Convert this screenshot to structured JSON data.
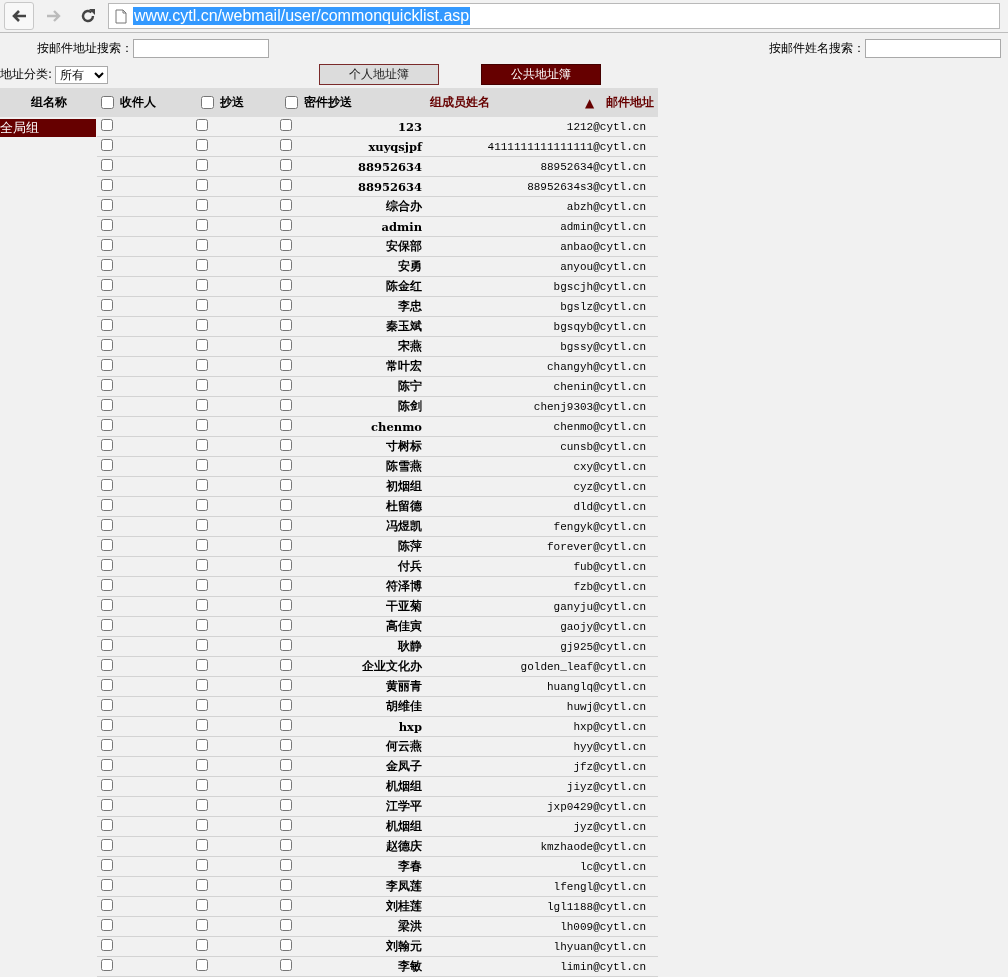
{
  "browser": {
    "url": "www.cytl.cn/webmail/user/commonquicklist.asp",
    "url_selected": true,
    "forward_disabled": true
  },
  "search": {
    "by_address_label": "按邮件地址搜索：",
    "by_name_label": "按邮件姓名搜索："
  },
  "category": {
    "label": "地址分类:",
    "value": "所有"
  },
  "address_books": [
    {
      "label": "个人地址簿",
      "selected": false
    },
    {
      "label": "公共地址簿",
      "selected": true
    }
  ],
  "table": {
    "group_header": "组名称",
    "to_header": {
      "label": "收件人",
      "checked": false
    },
    "cc_header": {
      "label": "抄送",
      "checked": false
    },
    "bcc_header": {
      "label": "密件抄送",
      "checked": false
    },
    "name_header": "组成员姓名",
    "sort_mark": "▲",
    "email_header": "邮件地址",
    "groups": [
      {
        "label": "全局组",
        "selected": true
      }
    ],
    "rows": [
      {
        "name": "123",
        "email": "1212@cytl.cn",
        "to": false,
        "cc": false,
        "bcc": false
      },
      {
        "name": "xuyqsjpf",
        "email": "4111111111111111@cytl.cn",
        "to": false,
        "cc": false,
        "bcc": false
      },
      {
        "name": "88952634",
        "email": "88952634@cytl.cn",
        "to": false,
        "cc": false,
        "bcc": false
      },
      {
        "name": "88952634",
        "email": "88952634s3@cytl.cn",
        "to": false,
        "cc": false,
        "bcc": false
      },
      {
        "name": "综合办",
        "email": "abzh@cytl.cn",
        "to": false,
        "cc": false,
        "bcc": false
      },
      {
        "name": "admin",
        "email": "admin@cytl.cn",
        "to": false,
        "cc": false,
        "bcc": false
      },
      {
        "name": "安保部",
        "email": "anbao@cytl.cn",
        "to": false,
        "cc": false,
        "bcc": false
      },
      {
        "name": "安勇",
        "email": "anyou@cytl.cn",
        "to": false,
        "cc": false,
        "bcc": false
      },
      {
        "name": "陈金红",
        "email": "bgscjh@cytl.cn",
        "to": false,
        "cc": false,
        "bcc": false
      },
      {
        "name": "李忠",
        "email": "bgslz@cytl.cn",
        "to": false,
        "cc": false,
        "bcc": false
      },
      {
        "name": "秦玉斌",
        "email": "bgsqyb@cytl.cn",
        "to": false,
        "cc": false,
        "bcc": false
      },
      {
        "name": "宋燕",
        "email": "bgssy@cytl.cn",
        "to": false,
        "cc": false,
        "bcc": false
      },
      {
        "name": "常叶宏",
        "email": "changyh@cytl.cn",
        "to": false,
        "cc": false,
        "bcc": false
      },
      {
        "name": "陈宁",
        "email": "chenin@cytl.cn",
        "to": false,
        "cc": false,
        "bcc": false
      },
      {
        "name": "陈剑",
        "email": "chenj9303@cytl.cn",
        "to": false,
        "cc": false,
        "bcc": false
      },
      {
        "name": "chenmo",
        "email": "chenmo@cytl.cn",
        "to": false,
        "cc": false,
        "bcc": false
      },
      {
        "name": "寸树标",
        "email": "cunsb@cytl.cn",
        "to": false,
        "cc": false,
        "bcc": false
      },
      {
        "name": "陈雪燕",
        "email": "cxy@cytl.cn",
        "to": false,
        "cc": false,
        "bcc": false
      },
      {
        "name": "初烟组",
        "email": "cyz@cytl.cn",
        "to": false,
        "cc": false,
        "bcc": false
      },
      {
        "name": "杜留德",
        "email": "dld@cytl.cn",
        "to": false,
        "cc": false,
        "bcc": false
      },
      {
        "name": "冯煜凯",
        "email": "fengyk@cytl.cn",
        "to": false,
        "cc": false,
        "bcc": false
      },
      {
        "name": "陈萍",
        "email": "forever@cytl.cn",
        "to": false,
        "cc": false,
        "bcc": false
      },
      {
        "name": "付兵",
        "email": "fub@cytl.cn",
        "to": false,
        "cc": false,
        "bcc": false
      },
      {
        "name": "符泽博",
        "email": "fzb@cytl.cn",
        "to": false,
        "cc": false,
        "bcc": false
      },
      {
        "name": "干亚菊",
        "email": "ganyju@cytl.cn",
        "to": false,
        "cc": false,
        "bcc": false
      },
      {
        "name": "高佳寅",
        "email": "gaojy@cytl.cn",
        "to": false,
        "cc": false,
        "bcc": false
      },
      {
        "name": "耿静",
        "email": "gj925@cytl.cn",
        "to": false,
        "cc": false,
        "bcc": false
      },
      {
        "name": "企业文化办",
        "email": "golden_leaf@cytl.cn",
        "to": false,
        "cc": false,
        "bcc": false
      },
      {
        "name": "黄丽青",
        "email": "huanglq@cytl.cn",
        "to": false,
        "cc": false,
        "bcc": false
      },
      {
        "name": "胡维佳",
        "email": "huwj@cytl.cn",
        "to": false,
        "cc": false,
        "bcc": false
      },
      {
        "name": "hxp",
        "email": "hxp@cytl.cn",
        "to": false,
        "cc": false,
        "bcc": false
      },
      {
        "name": "何云燕",
        "email": "hyy@cytl.cn",
        "to": false,
        "cc": false,
        "bcc": false
      },
      {
        "name": "金凤子",
        "email": "jfz@cytl.cn",
        "to": false,
        "cc": false,
        "bcc": false
      },
      {
        "name": "机烟组",
        "email": "jiyz@cytl.cn",
        "to": false,
        "cc": false,
        "bcc": false
      },
      {
        "name": "江学平",
        "email": "jxp0429@cytl.cn",
        "to": false,
        "cc": false,
        "bcc": false
      },
      {
        "name": "机烟组",
        "email": "jyz@cytl.cn",
        "to": false,
        "cc": false,
        "bcc": false
      },
      {
        "name": "赵德庆",
        "email": "kmzhaode@cytl.cn",
        "to": false,
        "cc": false,
        "bcc": false
      },
      {
        "name": "李春",
        "email": "lc@cytl.cn",
        "to": false,
        "cc": false,
        "bcc": false
      },
      {
        "name": "李凤莲",
        "email": "lfengl@cytl.cn",
        "to": false,
        "cc": false,
        "bcc": false
      },
      {
        "name": "刘桂莲",
        "email": "lgl1188@cytl.cn",
        "to": false,
        "cc": false,
        "bcc": false
      },
      {
        "name": "梁洪",
        "email": "lh009@cytl.cn",
        "to": false,
        "cc": false,
        "bcc": false
      },
      {
        "name": "刘翰元",
        "email": "lhyuan@cytl.cn",
        "to": false,
        "cc": false,
        "bcc": false
      },
      {
        "name": "李敏",
        "email": "limin@cytl.cn",
        "to": false,
        "cc": false,
        "bcc": false
      }
    ]
  }
}
